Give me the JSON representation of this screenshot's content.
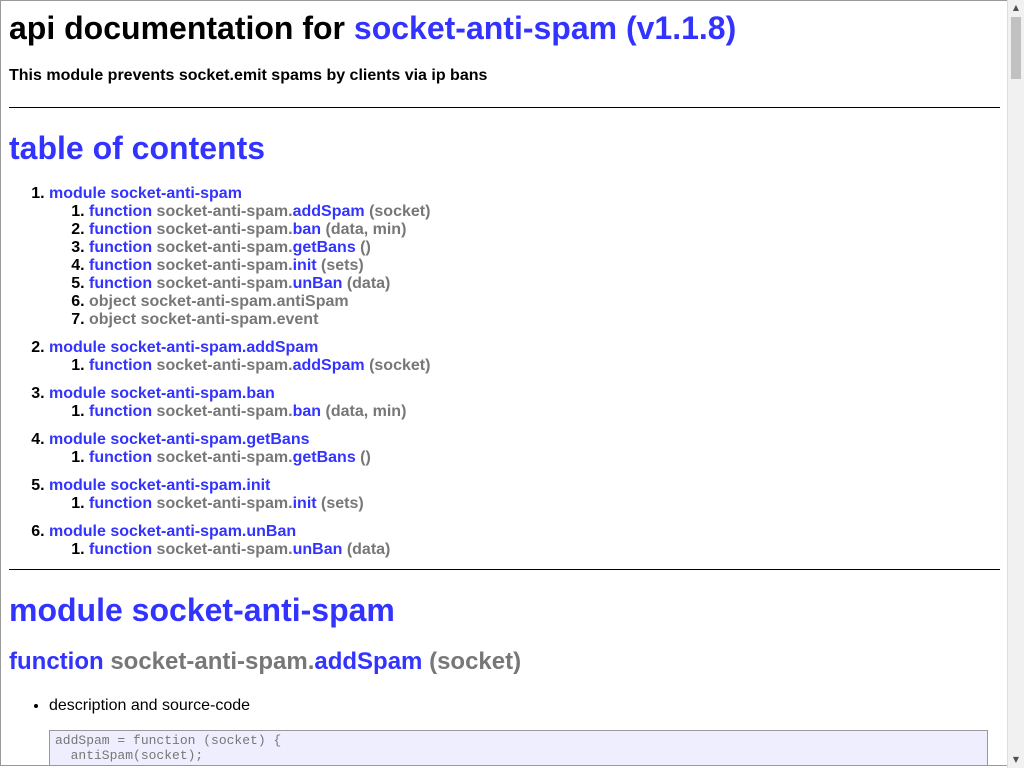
{
  "header": {
    "title_prefix": "api documentation for ",
    "title_link": "socket-anti-spam (v1.1.8)",
    "subtitle": "This module prevents socket.emit spams by clients via ip bans"
  },
  "toc": {
    "title": "table of contents",
    "modules": [
      {
        "label": "module socket-anti-spam",
        "items": [
          {
            "kind": "function",
            "prefix": "socket-anti-spam.",
            "name": "addSpam",
            "args": "(socket)"
          },
          {
            "kind": "function",
            "prefix": "socket-anti-spam.",
            "name": "ban",
            "args": "(data, min)"
          },
          {
            "kind": "function",
            "prefix": "socket-anti-spam.",
            "name": "getBans",
            "args": "()"
          },
          {
            "kind": "function",
            "prefix": "socket-anti-spam.",
            "name": "init",
            "args": "(sets)"
          },
          {
            "kind": "function",
            "prefix": "socket-anti-spam.",
            "name": "unBan",
            "args": "(data)"
          },
          {
            "kind": "object",
            "text": "object socket-anti-spam.antiSpam"
          },
          {
            "kind": "object",
            "text": "object socket-anti-spam.event"
          }
        ]
      },
      {
        "label": "module socket-anti-spam.addSpam",
        "items": [
          {
            "kind": "function",
            "prefix": "socket-anti-spam.",
            "name": "addSpam",
            "args": "(socket)"
          }
        ]
      },
      {
        "label": "module socket-anti-spam.ban",
        "items": [
          {
            "kind": "function",
            "prefix": "socket-anti-spam.",
            "name": "ban",
            "args": "(data, min)"
          }
        ]
      },
      {
        "label": "module socket-anti-spam.getBans",
        "items": [
          {
            "kind": "function",
            "prefix": "socket-anti-spam.",
            "name": "getBans",
            "args": "()"
          }
        ]
      },
      {
        "label": "module socket-anti-spam.init",
        "items": [
          {
            "kind": "function",
            "prefix": "socket-anti-spam.",
            "name": "init",
            "args": "(sets)"
          }
        ]
      },
      {
        "label": "module socket-anti-spam.unBan",
        "items": [
          {
            "kind": "function",
            "prefix": "socket-anti-spam.",
            "name": "unBan",
            "args": "(data)"
          }
        ]
      }
    ]
  },
  "function_keyword": "function",
  "section": {
    "module_title": "module socket-anti-spam",
    "fn_prefix": "socket-anti-spam.",
    "fn_name": "addSpam",
    "fn_args": "(socket)",
    "bullet": "description and source-code",
    "code_line1": "addSpam = function (socket) {",
    "code_line2": "  antiSpam(socket);"
  },
  "colors": {
    "link": "#3333ff",
    "muted": "#777777",
    "code_bg": "#eeeeff"
  }
}
